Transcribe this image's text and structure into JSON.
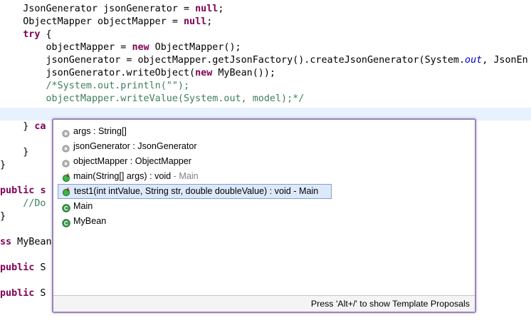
{
  "editor": {
    "lines": [
      {
        "tokens": [
          {
            "text": "    JsonGenerator jsonGenerator = "
          },
          {
            "text": "null",
            "cls": "kw"
          },
          {
            "text": ";"
          }
        ]
      },
      {
        "tokens": [
          {
            "text": "    ObjectMapper objectMapper = "
          },
          {
            "text": "null",
            "cls": "kw"
          },
          {
            "text": ";"
          }
        ]
      },
      {
        "tokens": [
          {
            "text": "    "
          },
          {
            "text": "try",
            "cls": "kw"
          },
          {
            "text": " {"
          }
        ]
      },
      {
        "tokens": [
          {
            "text": "        objectMapper = "
          },
          {
            "text": "new",
            "cls": "kw"
          },
          {
            "text": " ObjectMapper();"
          }
        ]
      },
      {
        "tokens": [
          {
            "text": "        jsonGenerator = objectMapper.getJsonFactory().createJsonGenerator(System."
          },
          {
            "text": "out",
            "cls": "static"
          },
          {
            "text": ", JsonEn"
          }
        ]
      },
      {
        "tokens": [
          {
            "text": "        jsonGenerator.writeObject("
          },
          {
            "text": "new",
            "cls": "kw"
          },
          {
            "text": " MyBean());"
          }
        ]
      },
      {
        "tokens": [
          {
            "text": "        /*System.out.println(",
            "cls": "comment"
          },
          {
            "text": "\"\"",
            "cls": "comment"
          },
          {
            "text": ");",
            "cls": "comment"
          }
        ]
      },
      {
        "tokens": [
          {
            "text": "        objectMapper.writeValue(System.out, model);*/",
            "cls": "comment"
          }
        ]
      },
      {
        "tokens": [
          {
            "text": ""
          }
        ],
        "current": true
      },
      {
        "tokens": [
          {
            "text": "    } "
          },
          {
            "text": "ca",
            "cls": "kw"
          }
        ]
      },
      {
        "tokens": [
          {
            "text": ""
          }
        ]
      },
      {
        "tokens": [
          {
            "text": "    }"
          }
        ]
      },
      {
        "tokens": [
          {
            "text": "}"
          }
        ]
      },
      {
        "tokens": [
          {
            "text": ""
          }
        ]
      },
      {
        "tokens": [
          {
            "text": "public",
            "cls": "kw"
          },
          {
            "text": " "
          },
          {
            "text": "s",
            "cls": "kw"
          }
        ]
      },
      {
        "tokens": [
          {
            "text": "    //Do",
            "cls": "comment"
          }
        ]
      },
      {
        "tokens": [
          {
            "text": "}"
          }
        ]
      },
      {
        "tokens": [
          {
            "text": ""
          }
        ]
      },
      {
        "tokens": [
          {
            "text": "ss",
            "cls": "kw"
          },
          {
            "text": " MyBean"
          }
        ]
      },
      {
        "tokens": [
          {
            "text": ""
          }
        ]
      },
      {
        "tokens": [
          {
            "text": "public",
            "cls": "kw"
          },
          {
            "text": " S"
          }
        ]
      },
      {
        "tokens": [
          {
            "text": ""
          }
        ]
      },
      {
        "tokens": [
          {
            "text": "public",
            "cls": "kw"
          },
          {
            "text": " S"
          }
        ]
      }
    ]
  },
  "popup": {
    "proposals": [
      {
        "label": "args : String[]",
        "desc": "",
        "icon": "local-variable-icon",
        "selected": false
      },
      {
        "label": "jsonGenerator : JsonGenerator",
        "desc": "",
        "icon": "local-variable-icon",
        "selected": false
      },
      {
        "label": "objectMapper : ObjectMapper",
        "desc": "",
        "icon": "local-variable-icon",
        "selected": false
      },
      {
        "label": "main(String[] args) : void",
        "desc": " - Main",
        "icon": "public-static-method-icon",
        "selected": false
      },
      {
        "label": "test1(int intValue, String str, double doubleValue) : void - Main",
        "desc": "",
        "icon": "public-static-method-icon",
        "selected": true
      },
      {
        "label": "Main",
        "desc": "",
        "icon": "class-icon",
        "selected": false
      },
      {
        "label": "MyBean",
        "desc": "",
        "icon": "class-icon",
        "selected": false
      }
    ],
    "footer": "Press 'Alt+/' to show Template Proposals"
  },
  "colors": {
    "keyword": "#7f0055",
    "comment": "#3f7f5f",
    "static_field": "#0000c0",
    "current_line": "#e8f2fe",
    "selection": "#dde8fb",
    "popup_border": "#9a86b8"
  }
}
